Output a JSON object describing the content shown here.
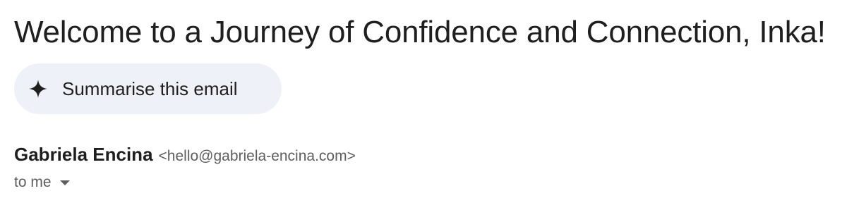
{
  "email": {
    "subject": "Welcome to a Journey of Confidence and Connection, Inka!",
    "summarise_label": "Summarise this email",
    "sender_name": "Gabriela Encina",
    "sender_email": "<hello@gabriela-encina.com>",
    "recipient_label": "to me"
  },
  "icons": {
    "summarise": "sparkle-icon",
    "recipient_details": "chevron-down-icon"
  },
  "colors": {
    "chip_background": "#eef1f7",
    "text_primary": "#1f1f1f",
    "text_secondary": "#5e5e5e"
  }
}
